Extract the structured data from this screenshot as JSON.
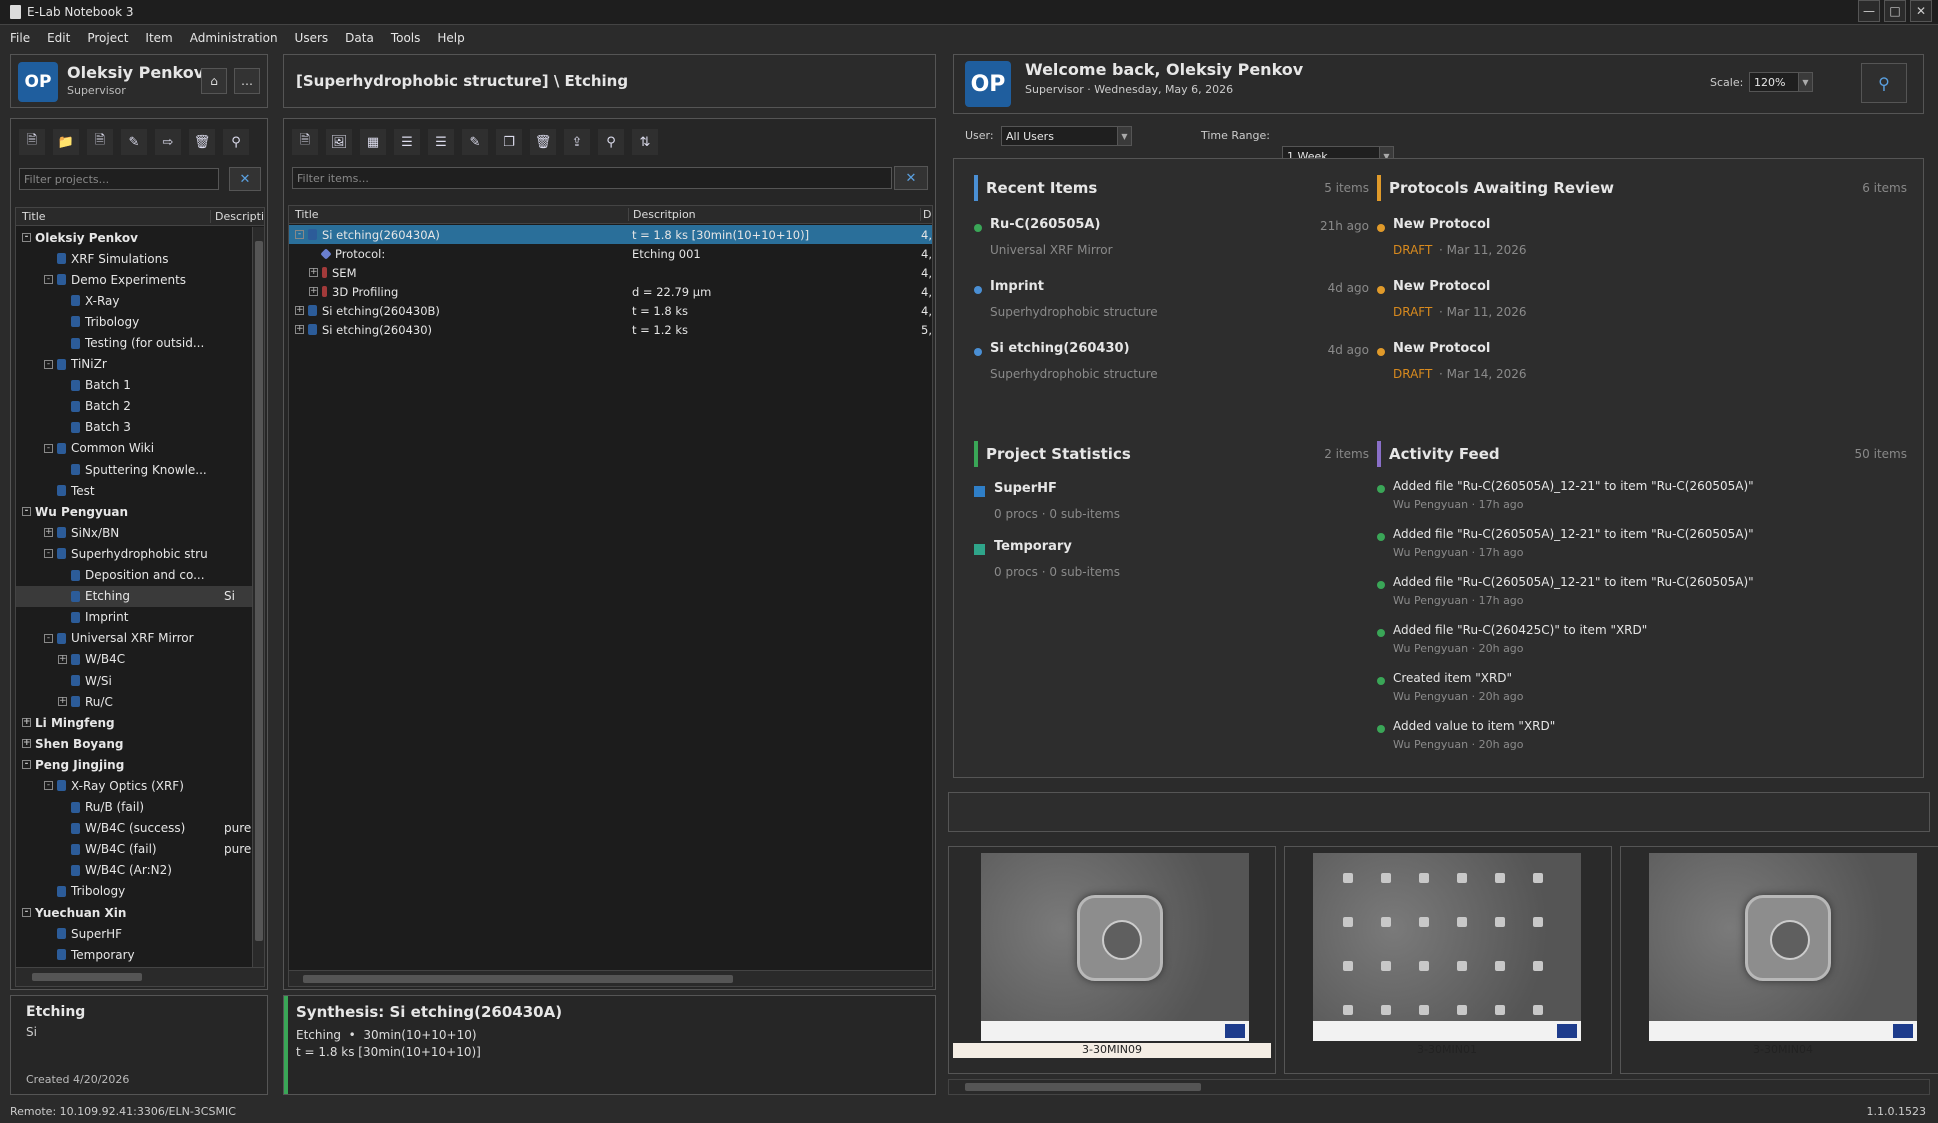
{
  "app": {
    "title": "E-Lab Notebook 3"
  },
  "menu": [
    "File",
    "Edit",
    "Project",
    "Item",
    "Administration",
    "Users",
    "Data",
    "Tools",
    "Help"
  ],
  "user": {
    "initials": "OP",
    "name": "Oleksiy Penkov",
    "role": "Supervisor"
  },
  "projects": {
    "filter_placeholder": "Filter projects...",
    "col_title": "Title",
    "col_desc": "Descripti",
    "tree": [
      {
        "label": "Oleksiy Penkov",
        "depth": 0,
        "bold": true,
        "pm": "-"
      },
      {
        "label": "XRF Simulations",
        "depth": 1
      },
      {
        "label": "Demo Experiments",
        "depth": 1,
        "pm": "-"
      },
      {
        "label": "X-Ray",
        "depth": 2
      },
      {
        "label": "Tribology",
        "depth": 2
      },
      {
        "label": "Testing (for outsid...",
        "depth": 2
      },
      {
        "label": "TiNiZr",
        "depth": 1,
        "pm": "-"
      },
      {
        "label": "Batch 1",
        "depth": 2
      },
      {
        "label": "Batch 2",
        "depth": 2
      },
      {
        "label": "Batch 3",
        "depth": 2
      },
      {
        "label": "Common Wiki",
        "depth": 1,
        "pm": "-"
      },
      {
        "label": "Sputtering Knowle...",
        "depth": 2
      },
      {
        "label": "Test",
        "depth": 1
      },
      {
        "label": "Wu Pengyuan",
        "depth": 0,
        "bold": true,
        "pm": "-"
      },
      {
        "label": "SiNx/BN",
        "depth": 1,
        "pm": "+"
      },
      {
        "label": "Superhydrophobic stru",
        "depth": 1,
        "pm": "-"
      },
      {
        "label": "Deposition and co...",
        "depth": 2
      },
      {
        "label": "Etching",
        "depth": 2,
        "desc": "Si",
        "selected": true
      },
      {
        "label": "Imprint",
        "depth": 2
      },
      {
        "label": "Universal XRF Mirror",
        "depth": 1,
        "pm": "-"
      },
      {
        "label": "W/B4C",
        "depth": 2,
        "pm": "+"
      },
      {
        "label": "W/Si",
        "depth": 2
      },
      {
        "label": "Ru/C",
        "depth": 2,
        "pm": "+"
      },
      {
        "label": "Li Mingfeng",
        "depth": 0,
        "bold": true,
        "pm": "+"
      },
      {
        "label": "Shen Boyang",
        "depth": 0,
        "bold": true,
        "pm": "+"
      },
      {
        "label": "Peng Jingjing",
        "depth": 0,
        "bold": true,
        "pm": "-"
      },
      {
        "label": "X-Ray Optics (XRF)",
        "depth": 1,
        "pm": "-"
      },
      {
        "label": "Ru/B (fail)",
        "depth": 2
      },
      {
        "label": "W/B4C (success)",
        "depth": 2,
        "desc": "pure"
      },
      {
        "label": "W/B4C (fail)",
        "depth": 2,
        "desc": "pure"
      },
      {
        "label": "W/B4C (Ar:N2)",
        "depth": 2
      },
      {
        "label": "Tribology",
        "depth": 1
      },
      {
        "label": "Yuechuan Xin",
        "depth": 0,
        "bold": true,
        "pm": "-"
      },
      {
        "label": "SuperHF",
        "depth": 1
      },
      {
        "label": "Temporary",
        "depth": 1
      }
    ]
  },
  "project_detail": {
    "title": "Etching",
    "desc": "Si",
    "created": "Created 4/20/2026"
  },
  "items": {
    "breadcrumb": "[Superhydrophobic structure] \\ Etching",
    "filter_placeholder": "Filter items...",
    "col_title": "Title",
    "col_desc": "Descritpion",
    "col_d": "D",
    "rows": [
      {
        "title": "Si etching(260430A)",
        "desc": "t = 1.8 ks [30min(10+10+10)]",
        "d": "4,",
        "depth": 0,
        "pm": "-",
        "selected": true
      },
      {
        "title": "Protocol:",
        "desc": "Etching 001",
        "d": "4,",
        "depth": 1,
        "kind": "protocol"
      },
      {
        "title": "SEM",
        "desc": "",
        "d": "4,",
        "depth": 1,
        "pm": "+",
        "kind": "data"
      },
      {
        "title": "3D Profiling",
        "desc": "d = 22.79 µm",
        "d": "4,",
        "depth": 1,
        "pm": "+",
        "kind": "data"
      },
      {
        "title": "Si etching(260430B)",
        "desc": "t = 1.8 ks",
        "d": "4,",
        "depth": 0,
        "pm": "+"
      },
      {
        "title": "Si etching(260430)",
        "desc": "t = 1.2 ks",
        "d": "5,",
        "depth": 0,
        "pm": "+"
      }
    ]
  },
  "synthesis": {
    "title": "Synthesis: Si etching(260430A)",
    "line1": "Etching  •  30min(10+10+10)",
    "line2": "t = 1.8 ks [30min(10+10+10)]",
    "accent": "#3aa657"
  },
  "welcome": {
    "title": "Welcome back, Oleksiy Penkov",
    "subtitle": "Supervisor · Wednesday, May 6, 2026",
    "scale_label": "Scale:",
    "scale_value": "120%"
  },
  "filters": {
    "user_label": "User:",
    "user_value": "All Users",
    "range_label": "Time Range:",
    "range_value": "1 Week"
  },
  "recent": {
    "title": "Recent Items",
    "count": "5 items",
    "color": "#4a8fd4",
    "items": [
      {
        "name": "Ru-C(260505A)",
        "time": "21h ago",
        "sub": "Universal XRF Mirror",
        "dot": "#3aa657"
      },
      {
        "name": "Imprint",
        "time": "4d ago",
        "sub": "Superhydrophobic structure",
        "dot": "#4a8fd4"
      },
      {
        "name": "Si etching(260430)",
        "time": "4d ago",
        "sub": "Superhydrophobic structure",
        "dot": "#4a8fd4"
      }
    ]
  },
  "protocols": {
    "title": "Protocols Awaiting Review",
    "count": "6 items",
    "color": "#e09a2a",
    "items": [
      {
        "name": "New Protocol",
        "status": "DRAFT",
        "date": "· Mar 11, 2026"
      },
      {
        "name": "New Protocol",
        "status": "DRAFT",
        "date": "· Mar 11, 2026"
      },
      {
        "name": "New Protocol",
        "status": "DRAFT",
        "date": "· Mar 14, 2026"
      }
    ]
  },
  "stats": {
    "title": "Project Statistics",
    "count": "2 items",
    "color": "#3aa657",
    "items": [
      {
        "name": "SuperHF",
        "sub": "0 procs · 0 sub-items",
        "color": "#2f7fc8"
      },
      {
        "name": "Temporary",
        "sub": "0 procs · 0 sub-items",
        "color": "#2fa58a"
      }
    ]
  },
  "activity": {
    "title": "Activity Feed",
    "count": "50 items",
    "color": "#8a6fc8",
    "items": [
      {
        "text": "Added file \"Ru-C(260505A)_12-21\" to item \"Ru-C(260505A)\"",
        "sub": "Wu Pengyuan · 17h ago"
      },
      {
        "text": "Added file \"Ru-C(260505A)_12-21\" to item \"Ru-C(260505A)\"",
        "sub": "Wu Pengyuan · 17h ago"
      },
      {
        "text": "Added file \"Ru-C(260505A)_12-21\" to item \"Ru-C(260505A)\"",
        "sub": "Wu Pengyuan · 17h ago"
      },
      {
        "text": "Added file \"Ru-C(260425C)\" to item \"XRD\"",
        "sub": "Wu Pengyuan · 20h ago"
      },
      {
        "text": "Created item \"XRD\"",
        "sub": "Wu Pengyuan · 20h ago"
      },
      {
        "text": "Added value to item \"XRD\"",
        "sub": "Wu Pengyuan · 20h ago"
      }
    ]
  },
  "images": [
    {
      "caption": "3-30MIN09",
      "selected": true,
      "variant": "center"
    },
    {
      "caption": "3-30MIN01",
      "selected": false,
      "variant": "grid"
    },
    {
      "caption": "3-30MIN04",
      "selected": false,
      "variant": "center"
    }
  ],
  "status": {
    "remote": "Remote: 10.109.92.41:3306/ELN-3CSMIC",
    "version": "1.1.0.1523"
  }
}
